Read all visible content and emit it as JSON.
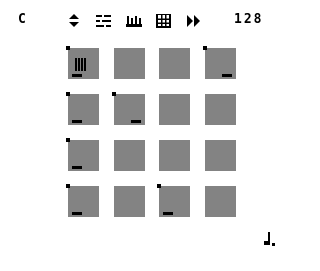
{
  "header": {
    "note_label": "C",
    "tempo": "128"
  },
  "toolbar": [
    {
      "name": "sort-arrows-icon"
    },
    {
      "name": "sequence-icon"
    },
    {
      "name": "piano-keys-icon"
    },
    {
      "name": "grid-icon"
    },
    {
      "name": "fast-forward-icon"
    }
  ],
  "pads": {
    "rows": 4,
    "cols": 4,
    "items": [
      {
        "row": 0,
        "col": 0,
        "marked": true,
        "bar": "left",
        "stripes": true
      },
      {
        "row": 0,
        "col": 1,
        "marked": false,
        "bar": "none",
        "stripes": false
      },
      {
        "row": 0,
        "col": 2,
        "marked": false,
        "bar": "none",
        "stripes": false
      },
      {
        "row": 0,
        "col": 3,
        "marked": true,
        "bar": "right",
        "stripes": false
      },
      {
        "row": 1,
        "col": 0,
        "marked": true,
        "bar": "left",
        "stripes": false
      },
      {
        "row": 1,
        "col": 1,
        "marked": true,
        "bar": "right",
        "stripes": false
      },
      {
        "row": 1,
        "col": 2,
        "marked": false,
        "bar": "none",
        "stripes": false
      },
      {
        "row": 1,
        "col": 3,
        "marked": false,
        "bar": "none",
        "stripes": false
      },
      {
        "row": 2,
        "col": 0,
        "marked": true,
        "bar": "left",
        "stripes": false
      },
      {
        "row": 2,
        "col": 1,
        "marked": false,
        "bar": "none",
        "stripes": false
      },
      {
        "row": 2,
        "col": 2,
        "marked": false,
        "bar": "none",
        "stripes": false
      },
      {
        "row": 2,
        "col": 3,
        "marked": false,
        "bar": "none",
        "stripes": false
      },
      {
        "row": 3,
        "col": 0,
        "marked": true,
        "bar": "left",
        "stripes": false
      },
      {
        "row": 3,
        "col": 1,
        "marked": false,
        "bar": "none",
        "stripes": false
      },
      {
        "row": 3,
        "col": 2,
        "marked": true,
        "bar": "left",
        "stripes": false
      },
      {
        "row": 3,
        "col": 3,
        "marked": false,
        "bar": "none",
        "stripes": false
      }
    ]
  },
  "footer": {
    "icon": "music-note-icon"
  },
  "colors": {
    "background": "#ffffff",
    "pad": "#838383",
    "ink": "#000000"
  }
}
